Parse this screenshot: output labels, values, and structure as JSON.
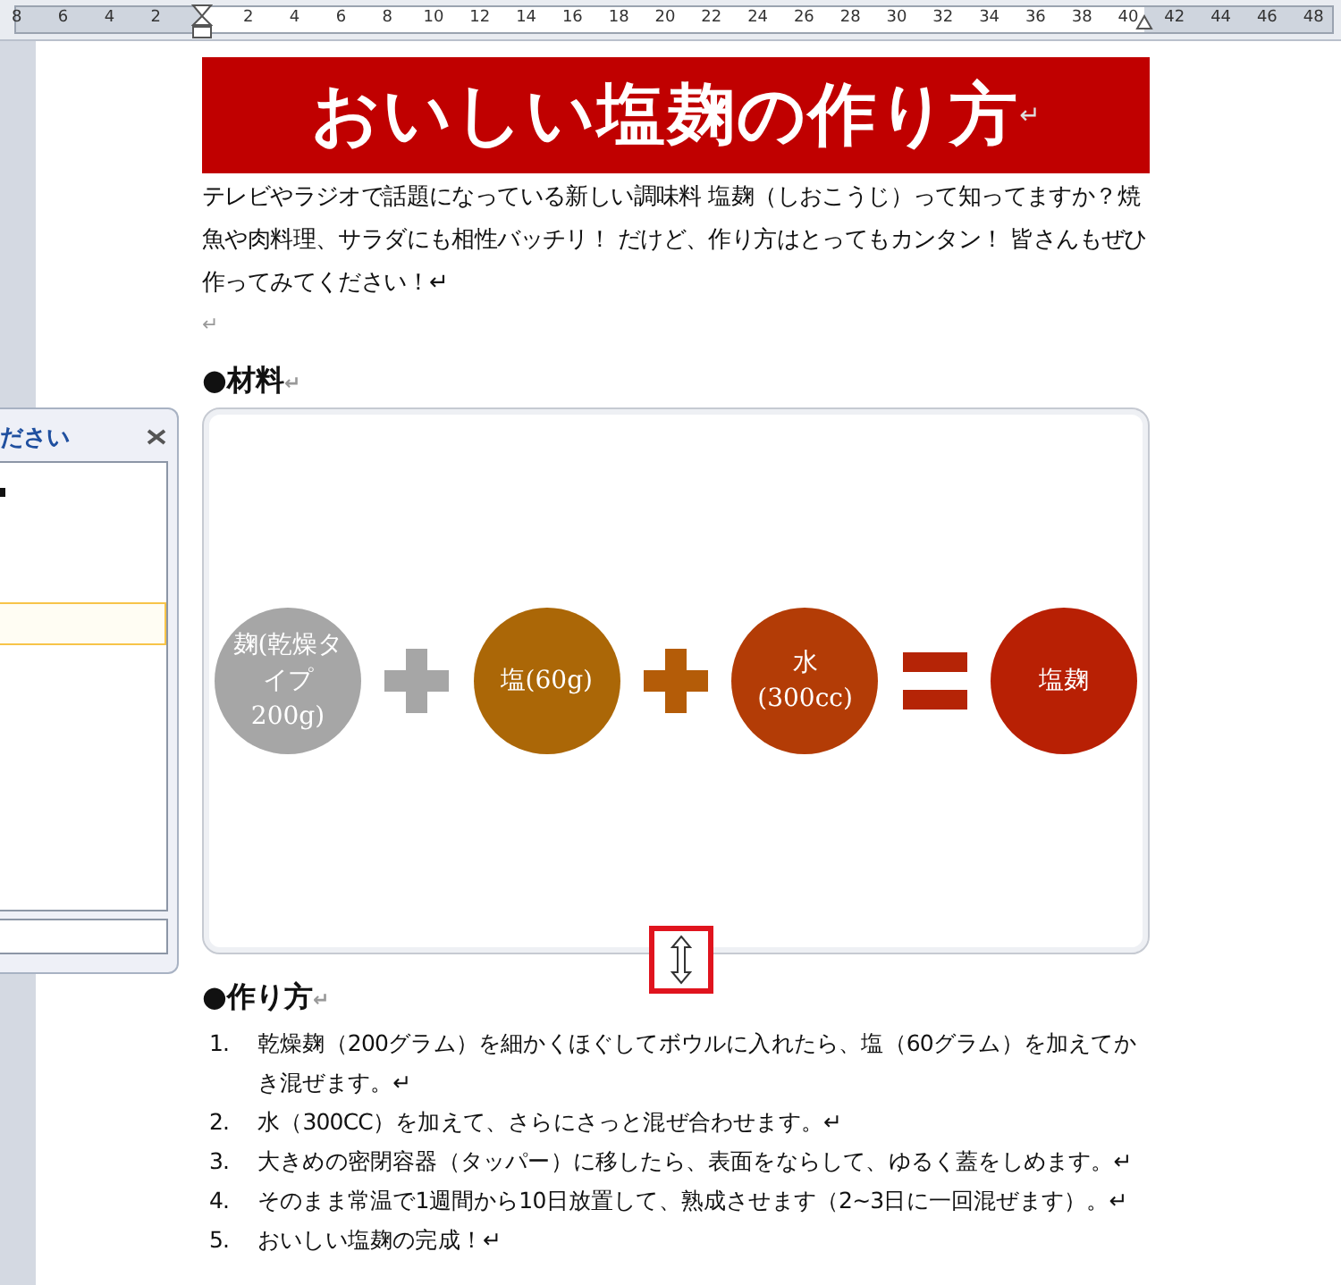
{
  "ruler": {
    "left_labels": [
      "8",
      "6",
      "4",
      "2"
    ],
    "right_labels": [
      "2",
      "4",
      "6",
      "8",
      "10",
      "12",
      "14",
      "16",
      "18",
      "20",
      "22",
      "24",
      "26",
      "28",
      "30",
      "32",
      "34",
      "36",
      "38",
      "40",
      "42",
      "44",
      "46",
      "48"
    ]
  },
  "document": {
    "title": "おいしい塩麹の作り方",
    "title_mark": "↵",
    "intro": "テレビやラジオで話題になっている新しい調味料 塩麹（しおこうじ）って知ってますか？焼魚や肉料理、サラダにも相性バッチリ！ だけど、作り方はとってもカンタン！ 皆さんもぜひ作ってみてください！↵",
    "blank_mark": "↵",
    "sections": [
      {
        "heading": "●材料",
        "heading_mark": "↵"
      },
      {
        "heading": "●作り方",
        "heading_mark": "↵"
      }
    ],
    "diagram": {
      "items": [
        {
          "kind": "circle",
          "label": "麹(乾燥タイプ200g)",
          "color": "#a6a6a6"
        },
        {
          "kind": "plus",
          "color": "#a6a6a6"
        },
        {
          "kind": "circle",
          "label": "塩(60g)",
          "color": "#ab6707"
        },
        {
          "kind": "plus",
          "color": "#b45c08"
        },
        {
          "kind": "circle",
          "label": "水(300cc)",
          "color": "#b33c06"
        },
        {
          "kind": "equals",
          "color": "#b52406"
        },
        {
          "kind": "circle",
          "label": "塩麹",
          "color": "#b82004"
        }
      ]
    },
    "steps": [
      {
        "number": "1.",
        "text": "乾燥麹（200グラム）を細かくほぐしてボウルに入れたら、塩（60グラム）を加えてかき混ぜます。↵"
      },
      {
        "number": "2.",
        "text": "水（300CC）を加えて、さらにさっと混ぜ合わせます。↵"
      },
      {
        "number": "3.",
        "text": "大きめの密閉容器（タッパー）に移したら、表面をならして、ゆるく蓋をしめます。↵"
      },
      {
        "number": "4.",
        "text": "そのまま常温で1週間から10日放置して、熟成させます（2~3日に一回混ぜます）。↵"
      },
      {
        "number": "5.",
        "text": "おいしい塩麹の完成！↵"
      }
    ]
  },
  "text_pane": {
    "title": "ださい",
    "rows": [
      {
        "selected": false
      },
      {
        "selected": true
      }
    ]
  }
}
